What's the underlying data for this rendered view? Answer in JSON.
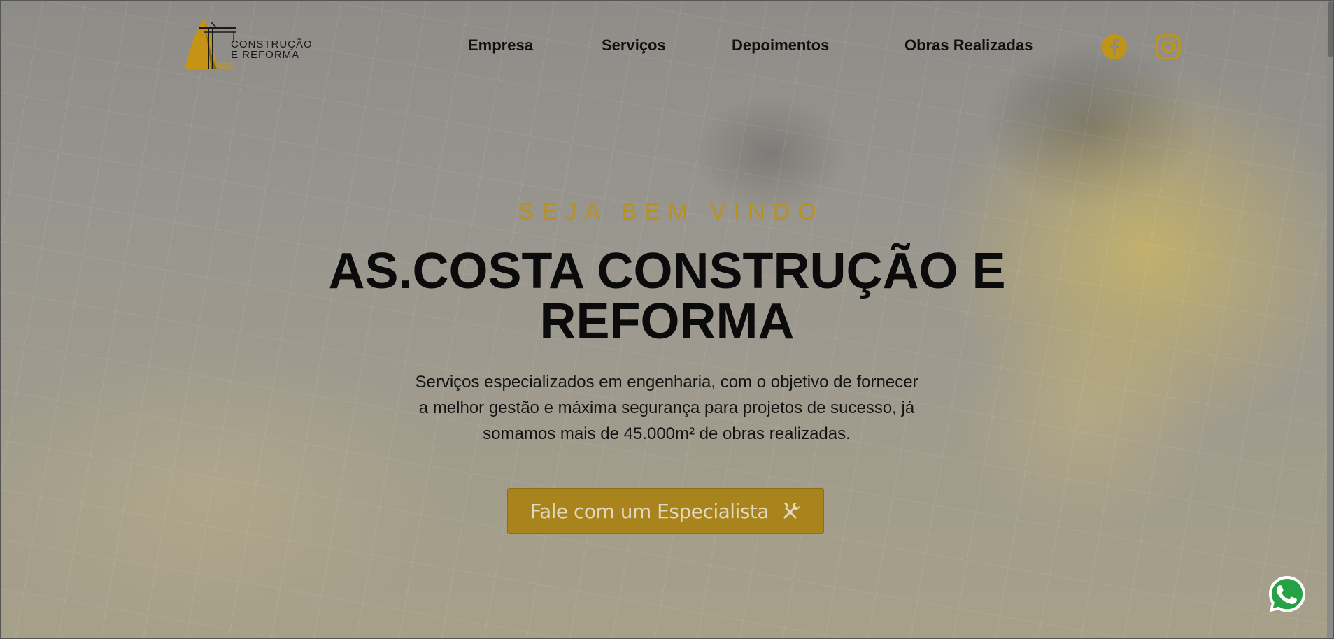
{
  "brand": {
    "logo_line1": "CONSTRUÇÃO",
    "logo_line2": "E REFORMA",
    "logo_abbr": "ASC",
    "accent_color": "#c8971a"
  },
  "nav": {
    "items": [
      {
        "label": "Empresa"
      },
      {
        "label": "Serviços"
      },
      {
        "label": "Depoimentos"
      },
      {
        "label": "Obras Realizadas"
      }
    ],
    "social": [
      "facebook-icon",
      "instagram-icon"
    ]
  },
  "hero": {
    "eyebrow": "SEJA BEM VINDO",
    "title_line1": "AS.COSTA CONSTRUÇÃO E",
    "title_line2": "REFORMA",
    "text_line1": "Serviços especializados em engenharia, com o objetivo de fornecer",
    "text_line2": "a melhor gestão e máxima segurança para projetos de sucesso, já",
    "text_line3": "somamos mais de 45.000m² de obras realizadas.",
    "cta_label": "Fale com um Especialista",
    "cta_icon": "tools-icon"
  },
  "floating": {
    "whatsapp_icon": "whatsapp-icon",
    "whatsapp_color": "#25a244"
  }
}
